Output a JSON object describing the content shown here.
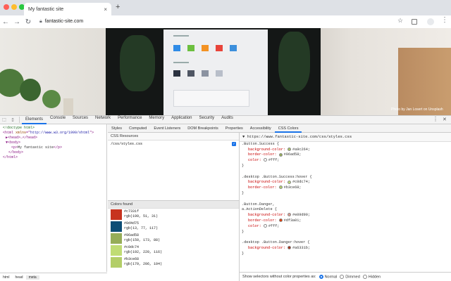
{
  "browser": {
    "tab_title": "My fantastic site",
    "new_tab": "+",
    "url": "fantastic-site.com"
  },
  "page": {
    "photo_credit": "Photo by Jan Losert on Unsplash"
  },
  "devtools": {
    "tabs": [
      "Elements",
      "Console",
      "Sources",
      "Network",
      "Performance",
      "Memory",
      "Application",
      "Security",
      "Audits"
    ],
    "active_tab": "Elements",
    "dom_lines": [
      {
        "parts": [
          {
            "t": "<!doctype html>",
            "c": "cmt"
          }
        ],
        "indent": 1
      },
      {
        "parts": [
          {
            "t": "<html ",
            "c": "tagc"
          },
          {
            "t": "xmlns",
            "c": "atn"
          },
          {
            "t": "=\"",
            "c": "tagc"
          },
          {
            "t": "http://www.w3.org/1999/xhtml",
            "c": "atv"
          },
          {
            "t": "\">",
            "c": "tagc"
          }
        ],
        "indent": 1
      },
      {
        "parts": [
          {
            "t": "▶<head>…</head>",
            "c": "tagc"
          }
        ],
        "indent": 2
      },
      {
        "parts": [
          {
            "t": "▼<body>",
            "c": "tagc"
          }
        ],
        "indent": 2
      },
      {
        "parts": [
          {
            "t": "<p>",
            "c": "tagc"
          },
          {
            "t": "My fantastic site",
            "c": ""
          },
          {
            "t": "</p>",
            "c": "tagc"
          }
        ],
        "indent": 4
      },
      {
        "parts": [
          {
            "t": "</body>",
            "c": "tagc"
          }
        ],
        "indent": 3
      },
      {
        "parts": [
          {
            "t": "</html>",
            "c": "tagc"
          }
        ],
        "indent": 1
      }
    ],
    "breadcrumbs": [
      "html",
      "head",
      "meta"
    ],
    "sub_tabs": [
      "Styles",
      "Computed",
      "Event Listeners",
      "DOM Breakpoints",
      "Properties",
      "Accessibility",
      "CSS Colors"
    ],
    "active_sub_tab": "CSS Colors",
    "css_resources_title": "CSS Resources",
    "css_resource": "/css/styles.css",
    "colors_found_title": "Colors found",
    "colors": [
      {
        "hex": "#c7331f",
        "rgb": "rgb(199, 51, 31)"
      },
      {
        "hex": "#0d4d75",
        "rgb": "rgb(13, 77, 117)"
      },
      {
        "hex": "#96ad58",
        "rgb": "rgb(150, 173, 88)"
      },
      {
        "hex": "#c0dc74",
        "rgb": "rgb(192, 220, 116)"
      },
      {
        "hex": "#b3ce68",
        "rgb": "rgb(179, 206, 104)"
      }
    ],
    "code_header": "▼ https://www.fantastic-site.com/css/styles.css",
    "code_lines": [
      {
        "text": ".Button.Success {",
        "type": "sel"
      },
      {
        "text": "background-color:",
        "val": "#a9c264;",
        "dot": "#a9c264",
        "type": "prop"
      },
      {
        "text": "border-color:",
        "val": "#96ad58;",
        "dot": "#96ad58",
        "type": "prop"
      },
      {
        "text": "color:",
        "val": "#fff;",
        "dot": "#ffffff",
        "type": "prop"
      },
      {
        "text": "}",
        "type": "sel"
      },
      {
        "text": "",
        "type": "blank"
      },
      {
        "text": ".desktop .Button.Success:hover {",
        "type": "sel"
      },
      {
        "text": "background-color:",
        "val": "#c0dc74;",
        "dot": "#c0dc74",
        "type": "prop"
      },
      {
        "text": "border-color:",
        "val": "#b3ce68;",
        "dot": "#b3ce68",
        "type": "prop"
      },
      {
        "text": "}",
        "type": "sel"
      },
      {
        "text": "",
        "type": "blank"
      },
      {
        "text": ".Button.Danger,",
        "type": "sel"
      },
      {
        "text": "a.ActionDelete {",
        "type": "sel"
      },
      {
        "text": "background-color:",
        "val": "#e09d90;",
        "dot": "#e09d90",
        "type": "prop"
      },
      {
        "text": "border-color:",
        "val": "#df3a01;",
        "dot": "#df3a01",
        "type": "prop"
      },
      {
        "text": "color:",
        "val": "#fff;",
        "dot": "#ffffff",
        "type": "prop"
      },
      {
        "text": "}",
        "type": "sel"
      },
      {
        "text": "",
        "type": "blank"
      },
      {
        "text": ".desktop .Button.Danger:hover {",
        "type": "sel"
      },
      {
        "text": "background-color:",
        "val": "#a6331b;",
        "dot": "#a6331b",
        "type": "prop"
      },
      {
        "text": "}",
        "type": "sel"
      }
    ],
    "footer_label": "Show selectors without color properties as:",
    "footer_options": [
      "Normal",
      "Dimmed",
      "Hidden"
    ],
    "footer_selected": "Normal"
  },
  "colors": {
    "accent": "#1a73e8",
    "tabbar": "#dee1e6"
  }
}
